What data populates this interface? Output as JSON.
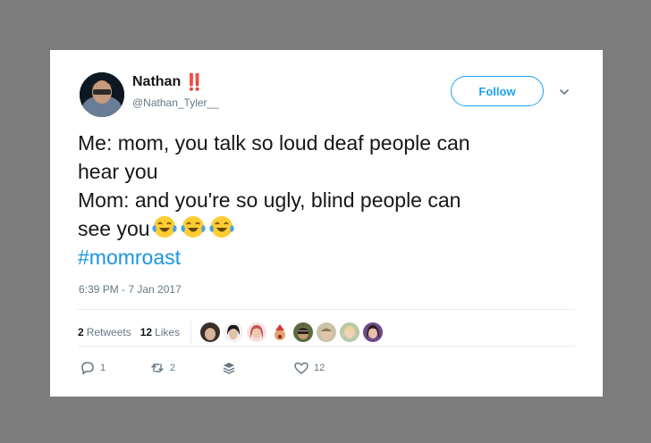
{
  "tweet": {
    "display_name": "Nathan",
    "name_emoji": "‼️",
    "handle": "@Nathan_Tyler__",
    "follow_label": "Follow",
    "text_lines": [
      "Me: mom, you talk so loud deaf people can",
      "hear you",
      "Mom: and you're so ugly, blind people can",
      "see you"
    ],
    "emojis": [
      "😂",
      "😂",
      "😂"
    ],
    "hashtag": "#momroast",
    "timestamp": "6:39 PM - 7 Jan 2017",
    "stats": {
      "retweets_count": "2",
      "retweets_label": "Retweets",
      "likes_count": "12",
      "likes_label": "Likes"
    },
    "actions": {
      "reply_count": "1",
      "retweet_count": "2",
      "like_count": "12"
    }
  },
  "colors": {
    "accent": "#1da1f2",
    "hashtag": "#1b95e0",
    "text": "#14171a",
    "muted": "#657786",
    "background": "#7c7c7c"
  },
  "icons": [
    "caret-down-icon",
    "reply-icon",
    "retweet-icon",
    "dm-icon",
    "heart-icon"
  ]
}
